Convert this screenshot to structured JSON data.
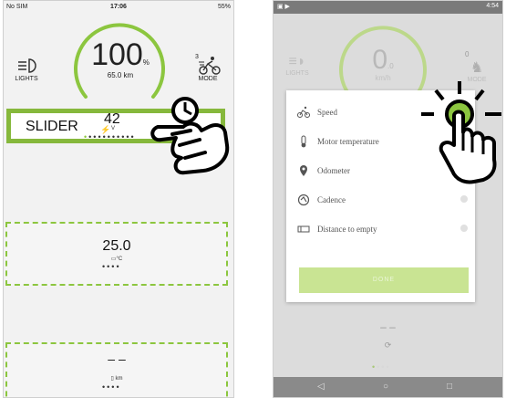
{
  "left": {
    "status": {
      "carrier": "No SIM",
      "time": "17:06",
      "battery": "55%"
    },
    "speed": {
      "value": "100",
      "unit": "%",
      "sub": "65.0 km"
    },
    "lights_label": "LIGHTS",
    "mode_label": "MODE",
    "mode_number": "3",
    "slider": {
      "label": "SLIDER",
      "value": "42",
      "unit": "V"
    },
    "card1": {
      "value": "25.0",
      "unit": "°C"
    },
    "card2": {
      "value": "– –",
      "unit": "km"
    }
  },
  "right": {
    "status": {
      "time": "4:54"
    },
    "speed": {
      "value": "0",
      "unit": ".0",
      "sub": "km/h"
    },
    "lights_label": "LIGHTS",
    "mode_label": "MODE",
    "mode_number": "0",
    "modal": {
      "items": [
        {
          "label": "Speed",
          "icon": "bicycle-icon"
        },
        {
          "label": "Motor temperature",
          "icon": "thermometer-icon"
        },
        {
          "label": "Odometer",
          "icon": "location-pin-icon"
        },
        {
          "label": "Cadence",
          "icon": "cadence-icon"
        },
        {
          "label": "Distance to empty",
          "icon": "battery-range-icon"
        }
      ],
      "done_label": "DONE"
    },
    "bottom_value": "– –"
  },
  "colors": {
    "accent": "#8cc63f",
    "slider_border": "#86b83c",
    "done": "#c9e493"
  }
}
